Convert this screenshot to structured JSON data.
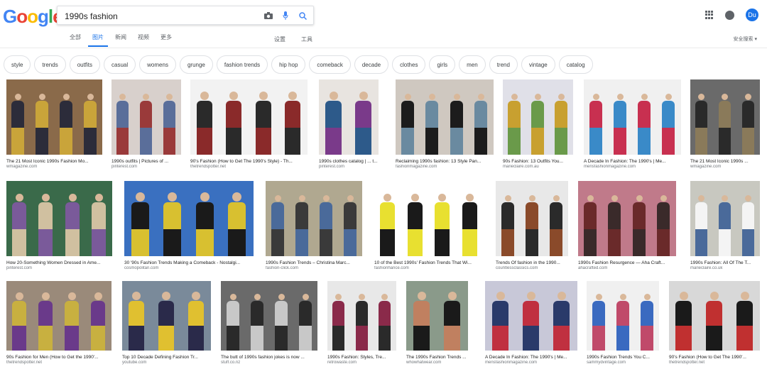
{
  "header": {
    "logo_text": "Google",
    "search": {
      "value": "1990s fashion",
      "placeholder": ""
    },
    "avatar_initials": "Du"
  },
  "tabs": [
    {
      "label": "全部",
      "active": false
    },
    {
      "label": "图片",
      "active": true
    },
    {
      "label": "新闻",
      "active": false
    },
    {
      "label": "视频",
      "active": false
    },
    {
      "label": "更多",
      "active": false
    }
  ],
  "tools": {
    "settings": "设置",
    "tools": "工具",
    "safe_search": "安全搜索 ▾"
  },
  "chips": [
    "style",
    "trends",
    "outfits",
    "casual",
    "womens",
    "grunge",
    "fashion trends",
    "hip hop",
    "comeback",
    "decade",
    "clothes",
    "girls",
    "men",
    "trend",
    "vintage",
    "catalog"
  ],
  "rows": [
    [
      {
        "caption": "The 21 Most Iconic 1990s Fashion Mo...",
        "source": "wmagazine.com",
        "colors": [
          "#8a6a4a",
          "#2c2c3a",
          "#c9a43a"
        ]
      },
      {
        "caption": "1990s outfits | Pictures of ...",
        "source": "pinterest.com",
        "colors": [
          "#d8d0cc",
          "#5a6e9a",
          "#9a3a3a"
        ]
      },
      {
        "caption": "90's Fashion (How to Get The 1990's Style) - Th...",
        "source": "thetrendspotter.net",
        "colors": [
          "#f2f2f2",
          "#2a2a2a",
          "#8a2a2a"
        ]
      },
      {
        "caption": "1990s clothes catalog | ... t...",
        "source": "pinterest.com",
        "colors": [
          "#e8e4e0",
          "#2d5a8a",
          "#7a3a8a"
        ]
      },
      {
        "caption": "Reclaiming 1990s fashion: 13 Style Pan...",
        "source": "fashionmagazine.com",
        "colors": [
          "#cfc8c0",
          "#1c1c1c",
          "#6a8aa0"
        ]
      },
      {
        "caption": "90s Fashion: 13 Outfits You...",
        "source": "marieclaire.com.au",
        "colors": [
          "#e0e0e8",
          "#c8a030",
          "#6a9a4a"
        ]
      },
      {
        "caption": "A Decade In Fashion: The 1990's | Me...",
        "source": "mensfashionmagazine.com",
        "colors": [
          "#f0f0f0",
          "#c83050",
          "#3a8ac8"
        ]
      },
      {
        "caption": "The 21 Most Iconic 1990s ...",
        "source": "wmagazine.com",
        "colors": [
          "#6a6a6a",
          "#2a2a2a",
          "#8a7a5a"
        ]
      }
    ],
    [
      {
        "caption": "How 20-Something Women Dressed in Ame...",
        "source": "pinterest.com",
        "colors": [
          "#3a6a4a",
          "#7a5a9a",
          "#d0c0a0"
        ]
      },
      {
        "caption": "30 '90s Fashion Trends Making a Comeback - Nostalgi...",
        "source": "cosmopolitan.com",
        "colors": [
          "#3a70c0",
          "#1a1a1a",
          "#d8c030"
        ]
      },
      {
        "caption": "1990s Fashion Trends – Christina Marc...",
        "source": "fashion-click.com",
        "colors": [
          "#b0a890",
          "#4a6a9a",
          "#3a3a3a"
        ]
      },
      {
        "caption": "10 of the Best 1990s' Fashion Trends That Wi...",
        "source": "fashionhance.com",
        "colors": [
          "#ffffff",
          "#e8e030",
          "#1a1a1a"
        ]
      },
      {
        "caption": "Trends Of fashion in the 1990...",
        "source": "countlessclassics.com",
        "colors": [
          "#e8e8e8",
          "#2a2a2a",
          "#8a4a2a"
        ]
      },
      {
        "caption": "1990s Fashion Resurgence — Aha Craft...",
        "source": "ahacrafted.com",
        "colors": [
          "#c07a8a",
          "#6a2a2a",
          "#3a2a2a"
        ]
      },
      {
        "caption": "1990s Fashion: All Of The T...",
        "source": "marieclaire.co.uk",
        "colors": [
          "#c8c8c0",
          "#f4f4f4",
          "#4a6a9a"
        ]
      }
    ],
    [
      {
        "caption": "90s Fashion for Men (How to Get the 1990'...",
        "source": "thetrendspotter.net",
        "colors": [
          "#9a8a7a",
          "#c8b040",
          "#6a3a8a"
        ]
      },
      {
        "caption": "Top 10 Decade Defining Fashion Tr...",
        "source": "youtube.com",
        "colors": [
          "#7a8a9a",
          "#e0c030",
          "#2a2a4a"
        ]
      },
      {
        "caption": "The butt of 1990s fashion jokes is now ...",
        "source": "stuff.co.nz",
        "colors": [
          "#6a6a6a",
          "#c8c8c8",
          "#2a2a2a"
        ]
      },
      {
        "caption": "1990s Fashion: Styles, Tre...",
        "source": "retrowaste.com",
        "colors": [
          "#e8e8e8",
          "#8a2a4a",
          "#2a2a2a"
        ]
      },
      {
        "caption": "The 1990s Fashion Trends ...",
        "source": "whowhatwear.com",
        "colors": [
          "#8a9a8a",
          "#c08060",
          "#1a1a1a"
        ]
      },
      {
        "caption": "A Decade In Fashion: The 1990's | Me...",
        "source": "mensfashionmagazine.com",
        "colors": [
          "#c8c8d8",
          "#2a3a6a",
          "#c03040"
        ]
      },
      {
        "caption": "1990s Fashion Trends You C...",
        "source": "sammydvintage.com",
        "colors": [
          "#f0f0f0",
          "#3a6ac0",
          "#c04a6a"
        ]
      },
      {
        "caption": "90's Fashion (How to Get The 1990'...",
        "source": "thetrendspotter.net",
        "colors": [
          "#d8d8d8",
          "#1a1a1a",
          "#c03030"
        ]
      }
    ]
  ]
}
